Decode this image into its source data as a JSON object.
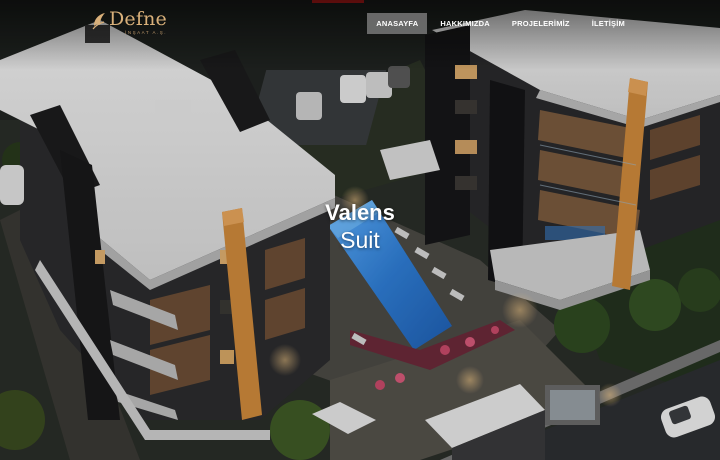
{
  "brand": {
    "name": "Defne",
    "subtitle": "İNŞAAT A.Ş.",
    "gold": "#d9b07a"
  },
  "nav": {
    "items": [
      {
        "label": "ANASAYFA",
        "active": true
      },
      {
        "label": "HAKKIMIZDA",
        "active": false
      },
      {
        "label": "PROJELERİMİZ",
        "active": false
      },
      {
        "label": "İLETİŞİM",
        "active": false
      }
    ]
  },
  "hero": {
    "title_line1": "Valens",
    "title_line2": "Suit"
  },
  "colors": {
    "pool": "#3f8fe0",
    "accent_red": "#e0201f",
    "facade_wood": "#7a5a3e",
    "pillar": "#d08a3c"
  },
  "icons": {
    "logo_mark": "leaf-emblem-icon"
  }
}
